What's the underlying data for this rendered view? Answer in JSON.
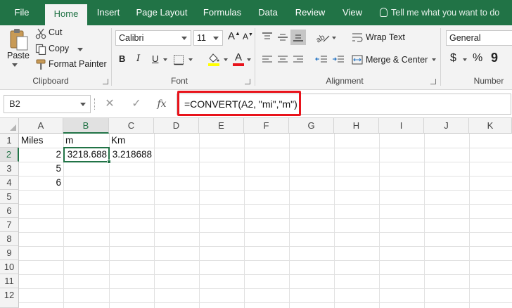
{
  "ribbon_tabs": [
    {
      "label": "File"
    },
    {
      "label": "Home",
      "active": true
    },
    {
      "label": "Insert"
    },
    {
      "label": "Page Layout"
    },
    {
      "label": "Formulas"
    },
    {
      "label": "Data"
    },
    {
      "label": "Review"
    },
    {
      "label": "View"
    }
  ],
  "tell_me": "Tell me what you want to do",
  "clipboard": {
    "paste": "Paste",
    "cut": "Cut",
    "copy": "Copy",
    "format_painter": "Format Painter",
    "group_label": "Clipboard"
  },
  "font": {
    "name": "Calibri",
    "size": "11",
    "bold": "B",
    "italic": "I",
    "underline": "U",
    "grow": "A",
    "shrink": "A",
    "group_label": "Font"
  },
  "alignment": {
    "wrap_text": "Wrap Text",
    "merge_center": "Merge & Center",
    "group_label": "Alignment"
  },
  "number": {
    "format": "General",
    "currency": "$",
    "percent": "%",
    "comma": "9",
    "group_label": "Number"
  },
  "formula_bar": {
    "name_box": "B2",
    "cancel": "✕",
    "enter": "✓",
    "fx": "fx",
    "formula": "=CONVERT(A2, \"mi\",\"m\")"
  },
  "grid": {
    "columns": [
      "A",
      "B",
      "C",
      "D",
      "E",
      "F",
      "G",
      "H",
      "I",
      "J",
      "K"
    ],
    "selected_column": "B",
    "rows": [
      "1",
      "2",
      "3",
      "4",
      "5",
      "6",
      "7",
      "8",
      "9",
      "10",
      "11",
      "12"
    ],
    "selected_row": "2",
    "cells": {
      "A1": "Miles",
      "B1": "m",
      "C1": "Km",
      "A2": "2",
      "B2": "3218.688",
      "C2": "3.218688",
      "A3": "5",
      "A4": "6"
    }
  },
  "colors": {
    "accent": "#217346",
    "highlight": "#e8131b",
    "font_color_bar": "#e8131b",
    "fill_color_bar": "#ffff00"
  }
}
